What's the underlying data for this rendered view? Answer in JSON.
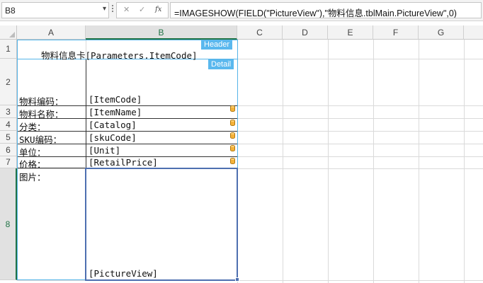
{
  "formula_bar": {
    "name_box": "B8",
    "name_box_arrow": "▾",
    "cancel_icon": "✕",
    "enter_icon": "✓",
    "fx_icon": "fx",
    "formula": "=IMAGESHOW(FIELD(\"PictureView\"),\"物料信息.tblMain.PictureView\",0)"
  },
  "grid": {
    "columns": [
      "A",
      "B",
      "C",
      "D",
      "E",
      "F",
      "G"
    ],
    "selected_column": "B",
    "rows": [
      "1",
      "2",
      "3",
      "4",
      "5",
      "6",
      "7",
      "8"
    ],
    "selected_row": "8"
  },
  "bands": {
    "header_label": "Header",
    "detail_label": "Detail"
  },
  "cells": {
    "a1_title": "物料信息卡[Parameters.ItemCode]",
    "a2_label": "物料编码：",
    "b2_value": "[ItemCode]",
    "a3_label": "物料名称：",
    "b3_value": "[ItemName]",
    "a4_label": "分类：",
    "b4_value": "[Catalog]",
    "a5_label": "SKU编码：",
    "b5_value": "[skuCode]",
    "a6_label": "单位：",
    "b6_value": "[Unit]",
    "a7_label": "价格：",
    "b7_value": "[RetailPrice]",
    "a8_label": "图片：",
    "b8_value": "[PictureView]"
  },
  "icons": {
    "field_marker": "database-field-icon"
  },
  "colors": {
    "band_border": "#55b4e8",
    "band_tag": "#5ab8ee",
    "selection": "#4d6fb0",
    "header_selected_text": "#217346",
    "field_marker": "#f4b23a"
  }
}
